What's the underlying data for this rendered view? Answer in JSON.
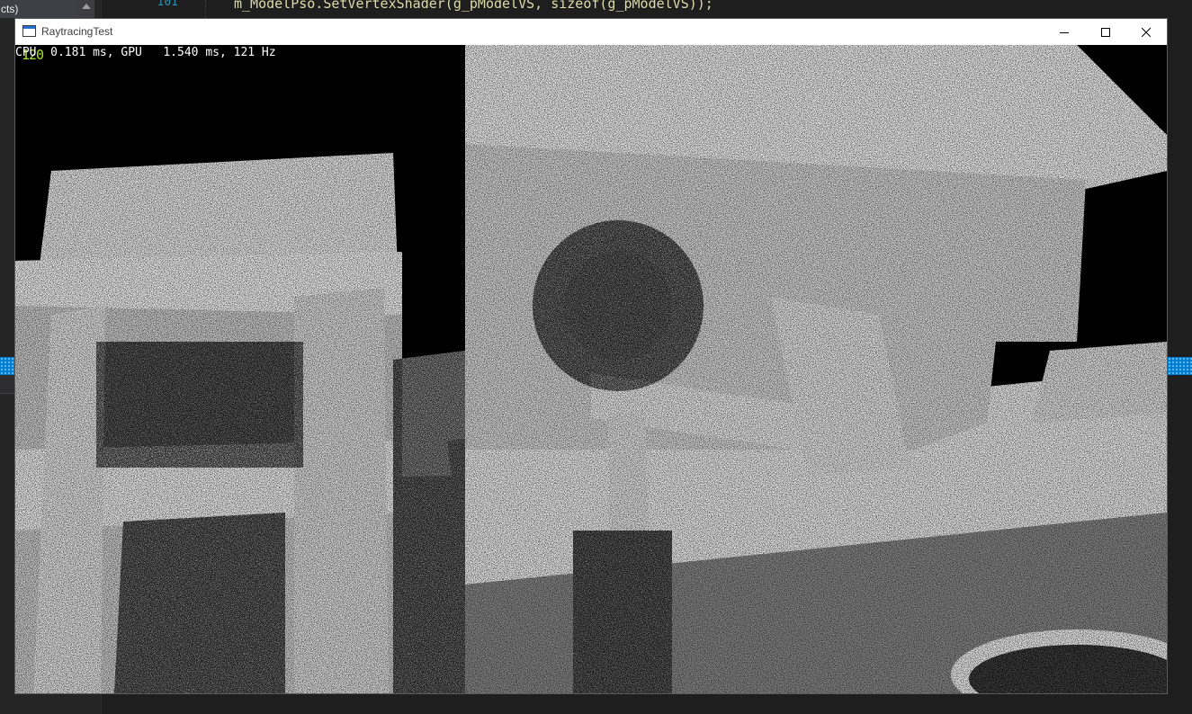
{
  "ide": {
    "solution_item_label": "cts)",
    "line_number": "101",
    "code_line": "m_ModelPso.SetVertexShader(g_pModelVS, sizeof(g_pModelVS));"
  },
  "window": {
    "title": "RaytracingTest",
    "icons": {
      "app": "app-window-icon",
      "minimize": "minimize-icon",
      "maximize": "maximize-icon",
      "close": "close-icon"
    }
  },
  "overlay": {
    "frame_counter": "120",
    "perf_text": "CPU  0.181 ms, GPU   1.540 ms, 121 Hz"
  },
  "scene": {
    "description_colors": {
      "background": "#000000",
      "lit_surface": "#f4f4f4",
      "shadow_surface": "#6a6a6a",
      "noise": "#000000"
    }
  },
  "colors": {
    "accent_blue": "#007acc",
    "line_number": "#2b91af",
    "overlay_green": "#a6e22e"
  }
}
